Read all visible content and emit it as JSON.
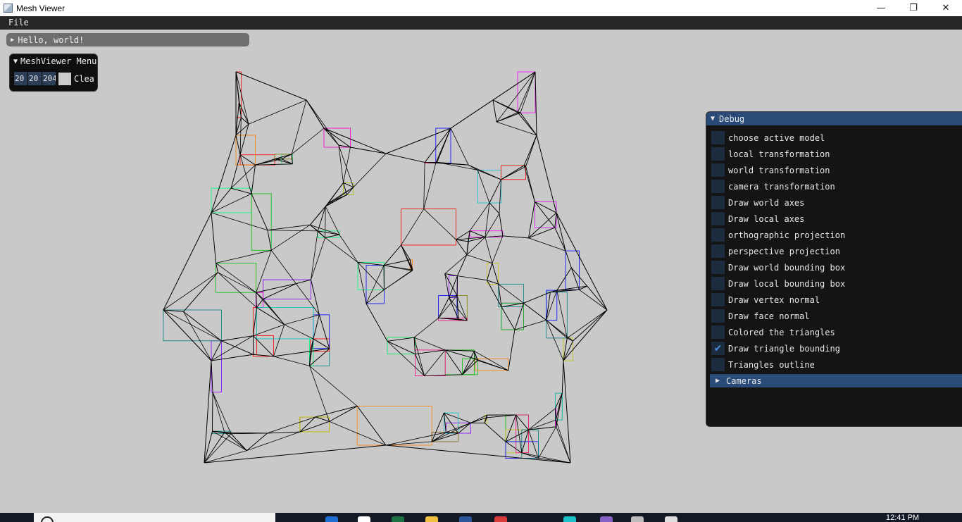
{
  "window": {
    "title": "Mesh Viewer",
    "minimize": "—",
    "restore": "❐",
    "close": "✕"
  },
  "menubar": {
    "file": "File"
  },
  "hello": {
    "label": "Hello, world!"
  },
  "meshviewer_menu": {
    "title": "MeshViewer Menu",
    "values": [
      "20",
      "20",
      "204"
    ],
    "clear_label": "Clea"
  },
  "debug": {
    "title": "Debug",
    "checkboxes": [
      {
        "label": "choose active model",
        "checked": false
      },
      {
        "label": "local transformation",
        "checked": false
      },
      {
        "label": "world transformation",
        "checked": false
      },
      {
        "label": "camera transformation",
        "checked": false
      },
      {
        "label": "Draw world axes",
        "checked": false
      },
      {
        "label": "Draw local axes",
        "checked": false
      },
      {
        "label": "orthographic projection",
        "checked": false
      },
      {
        "label": "perspective projection",
        "checked": false
      },
      {
        "label": "Draw world bounding box",
        "checked": false
      },
      {
        "label": "Draw local bounding box",
        "checked": false
      },
      {
        "label": "Draw vertex normal",
        "checked": false
      },
      {
        "label": "Draw face normal",
        "checked": false
      },
      {
        "label": "Colored the triangles",
        "checked": false
      },
      {
        "label": "Draw triangle bounding",
        "checked": true
      },
      {
        "label": "Triangles outline",
        "checked": false
      }
    ],
    "cameras_label": "Cameras"
  },
  "taskbar": {
    "clock": "12:41 PM"
  },
  "colors": {
    "viewport_bg": "#c9c9c9",
    "panel_header": "#2a4a78",
    "checkbox_bg": "#1d2b3f",
    "check_mark": "#4a90e2",
    "box_colors": [
      "#ff0000",
      "#00c000",
      "#0000ff",
      "#ff00ff",
      "#00c8c8",
      "#c8c800",
      "#ff8000",
      "#8000ff",
      "#00ff80",
      "#ff0080",
      "#008080",
      "#808000"
    ]
  }
}
